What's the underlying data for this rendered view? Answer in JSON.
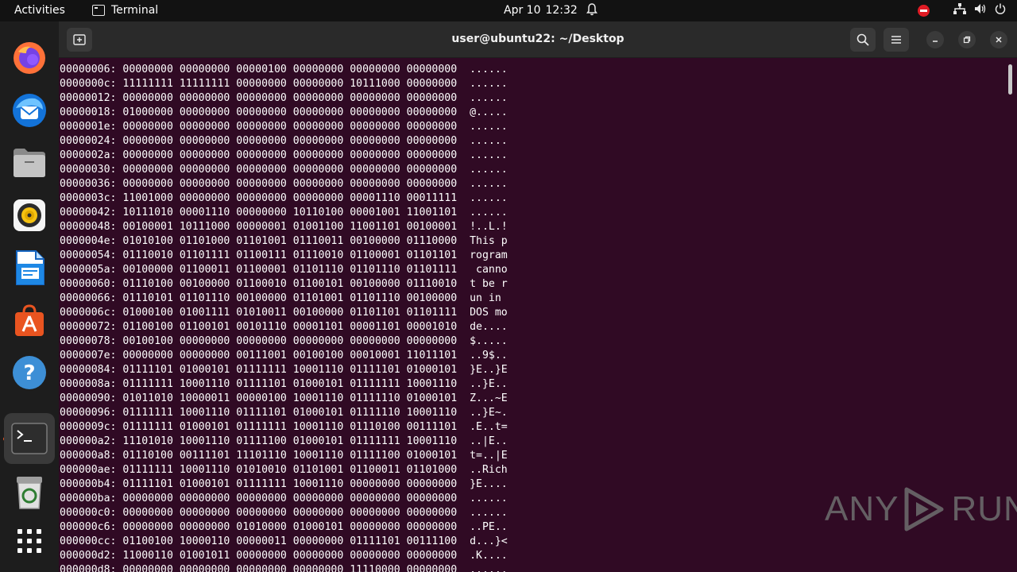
{
  "topbar": {
    "activities_label": "Activities",
    "app_menu_label": "Terminal",
    "date": "Apr 10",
    "time": "12:32"
  },
  "dock": {
    "items": [
      {
        "name": "firefox",
        "icon": "firefox-icon"
      },
      {
        "name": "thunderbird",
        "icon": "thunderbird-icon"
      },
      {
        "name": "files",
        "icon": "files-icon"
      },
      {
        "name": "rhythmbox",
        "icon": "rhythmbox-icon"
      },
      {
        "name": "libreoffice-writer",
        "icon": "writer-icon"
      },
      {
        "name": "app-center",
        "icon": "app-center-icon"
      },
      {
        "name": "help",
        "icon": "help-icon"
      },
      {
        "name": "terminal",
        "icon": "terminal-icon",
        "active": true
      },
      {
        "name": "trash",
        "icon": "trash-icon"
      },
      {
        "name": "show-apps",
        "icon": "grid-icon"
      }
    ]
  },
  "window": {
    "title": "user@ubuntu22: ~/Desktop"
  },
  "terminal": {
    "lines": [
      "00000006: 00000000 00000000 00000100 00000000 00000000 00000000  ......",
      "0000000c: 11111111 11111111 00000000 00000000 10111000 00000000  ......",
      "00000012: 00000000 00000000 00000000 00000000 00000000 00000000  ......",
      "00000018: 01000000 00000000 00000000 00000000 00000000 00000000  @.....",
      "0000001e: 00000000 00000000 00000000 00000000 00000000 00000000  ......",
      "00000024: 00000000 00000000 00000000 00000000 00000000 00000000  ......",
      "0000002a: 00000000 00000000 00000000 00000000 00000000 00000000  ......",
      "00000030: 00000000 00000000 00000000 00000000 00000000 00000000  ......",
      "00000036: 00000000 00000000 00000000 00000000 00000000 00000000  ......",
      "0000003c: 11001000 00000000 00000000 00000000 00001110 00011111  ......",
      "00000042: 10111010 00001110 00000000 10110100 00001001 11001101  ......",
      "00000048: 00100001 10111000 00000001 01001100 11001101 00100001  !..L.!",
      "0000004e: 01010100 01101000 01101001 01110011 00100000 01110000  This p",
      "00000054: 01110010 01101111 01100111 01110010 01100001 01101101  rogram",
      "0000005a: 00100000 01100011 01100001 01101110 01101110 01101111   canno",
      "00000060: 01110100 00100000 01100010 01100101 00100000 01110010  t be r",
      "00000066: 01110101 01101110 00100000 01101001 01101110 00100000  un in ",
      "0000006c: 01000100 01001111 01010011 00100000 01101101 01101111  DOS mo",
      "00000072: 01100100 01100101 00101110 00001101 00001101 00001010  de....",
      "00000078: 00100100 00000000 00000000 00000000 00000000 00000000  $.....",
      "0000007e: 00000000 00000000 00111001 00100100 00010001 11011101  ..9$..",
      "00000084: 01111101 01000101 01111111 10001110 01111101 01000101  }E..}E",
      "0000008a: 01111111 10001110 01111101 01000101 01111111 10001110  ..}E..",
      "00000090: 01011010 10000011 00000100 10001110 01111110 01000101  Z...~E",
      "00000096: 01111111 10001110 01111101 01000101 01111110 10001110  ..}E~.",
      "0000009c: 01111111 01000101 01111111 10001110 01110100 00111101  .E..t=",
      "000000a2: 11101010 10001110 01111100 01000101 01111111 10001110  ..|E..",
      "000000a8: 01110100 00111101 11101110 10001110 01111100 01000101  t=..|E",
      "000000ae: 01111111 10001110 01010010 01101001 01100011 01101000  ..Rich",
      "000000b4: 01111101 01000101 01111111 10001110 00000000 00000000  }E....",
      "000000ba: 00000000 00000000 00000000 00000000 00000000 00000000  ......",
      "000000c0: 00000000 00000000 00000000 00000000 00000000 00000000  ......",
      "000000c6: 00000000 00000000 01010000 01000101 00000000 00000000  ..PE..",
      "000000cc: 01100100 10000110 00000011 00000000 01111101 00111100  d...}<",
      "000000d2: 11000110 01001011 00000000 00000000 00000000 00000000  .K....",
      "000000d8: 00000000 00000000 00000000 00000000 11110000 00000000  ......"
    ]
  },
  "watermark": {
    "left_text": "ANY",
    "right_text": "RUN"
  },
  "colors": {
    "terminal_bg": "#300a24",
    "accent": "#e95420",
    "dnd": "#e01b24"
  }
}
